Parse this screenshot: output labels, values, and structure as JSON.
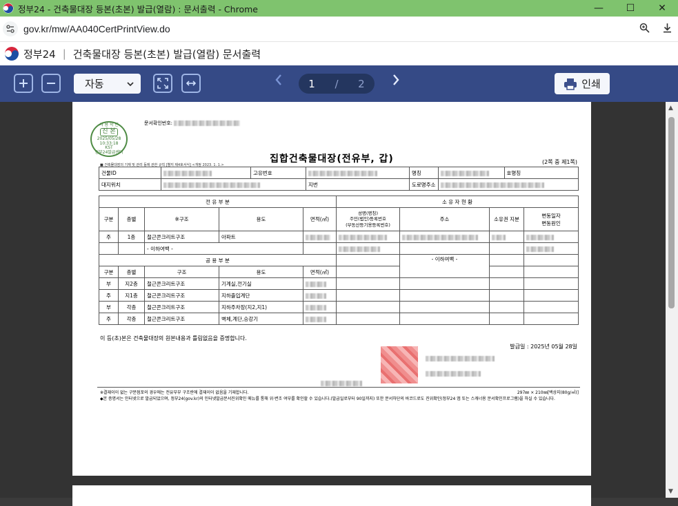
{
  "browser": {
    "window_title": "정부24 - 건축물대장 등본(초본) 발급(열람) : 문서출력 - Chrome",
    "url": "gov.kr/mw/AA040CertPrintView.do"
  },
  "site": {
    "brand": "정부24",
    "page_title": "건축물대장 등본(초본) 발급(열람) 문서출력"
  },
  "toolbar": {
    "zoom_value": "자동",
    "current_page": "1",
    "page_separator": "/",
    "total_pages": "2",
    "print_label": "인쇄"
  },
  "document": {
    "seal": {
      "line1": "사 용 학 인",
      "main": "진 본",
      "date": "2025/05/28",
      "time": "10:33:18",
      "tz": "KST",
      "issuer": "정부24발급센터"
    },
    "docno_label": "문서확인번호:",
    "title": "집합건축물대장(전유부, 갑)",
    "sheet_note": "(2쪽 중 제1쪽)",
    "small_note": "■ 건축물대장의 기재 및 관리 등에 관한 규칙 [별지 제4호서식] <개정 2023. 1. 1.>",
    "row1": {
      "building_id": "건물ID",
      "unique_no": "고유번호",
      "name": "명칭",
      "ho": "호명칭"
    },
    "row2": {
      "location": "대지위치",
      "jibun": "지번",
      "road": "도로명주소"
    },
    "exclusive_header": "전 유 부 분",
    "owner_header": "소 유 자 현 황",
    "cols": {
      "gubun": "구분",
      "floor": "층별",
      "structure_ex": "※구조",
      "use": "용도",
      "area": "면적(㎡)",
      "owner_name": "성명(명칭)",
      "owner_id": "주민(법인)등록번호",
      "owner_id2": "(부동산등기용등록번호)",
      "address": "주소",
      "share": "소유권 지분",
      "change_date": "변동일자",
      "change_reason": "변동원인"
    },
    "exclusive_rows": [
      {
        "gubun": "주",
        "floor": "1층",
        "structure": "철근콘크리트구조",
        "use": "아파트"
      }
    ],
    "blank_mark": "- 이하여백 -",
    "common_header": "공 용 부 분",
    "common_cols": {
      "gubun": "구분",
      "floor": "층별",
      "structure": "구조",
      "use": "용도",
      "area": "면적(㎡)"
    },
    "common_rows": [
      {
        "gubun": "부",
        "floor": "지2층",
        "structure": "철근콘크리트구조",
        "use": "기계실,전기실"
      },
      {
        "gubun": "주",
        "floor": "지1층",
        "structure": "철근콘크리트구조",
        "use": "지하출입계단"
      },
      {
        "gubun": "부",
        "floor": "각층",
        "structure": "철근콘크리트구조",
        "use": "지하주차장(지2,지1)"
      },
      {
        "gubun": "주",
        "floor": "각층",
        "structure": "철근콘크리트구조",
        "use": "벽체,계단,승강기"
      }
    ],
    "owner_blank": "- 이하여백 -",
    "certify": "이 등(초)본은 건축물대장의 원본내용과 틀림없음을 증명합니다.",
    "issue_date": "발급일 : 2025년 05월 28일",
    "foot1": "※결재이이 없는 구분점포의 경우에는 전유부부 구조란에 결재이이 없음을 기재합니다.",
    "foot2": "◆본 증명서는 인터넷으로 발급되었으며, 정부24(gov.kr)의 인터넷발급문서진위확인 메뉴를 통해 위·변조 여부를 확인할 수 있습니다.(발급일로부터 90일까지) 또한 문서하단의 바코드로도 진위확인(정부24 앱 또는 스캐너용 문서확인프로그램)을 하실 수 있습니다.",
    "paper": "297㎜ × 210㎜[백상지(80g/㎡)]"
  }
}
